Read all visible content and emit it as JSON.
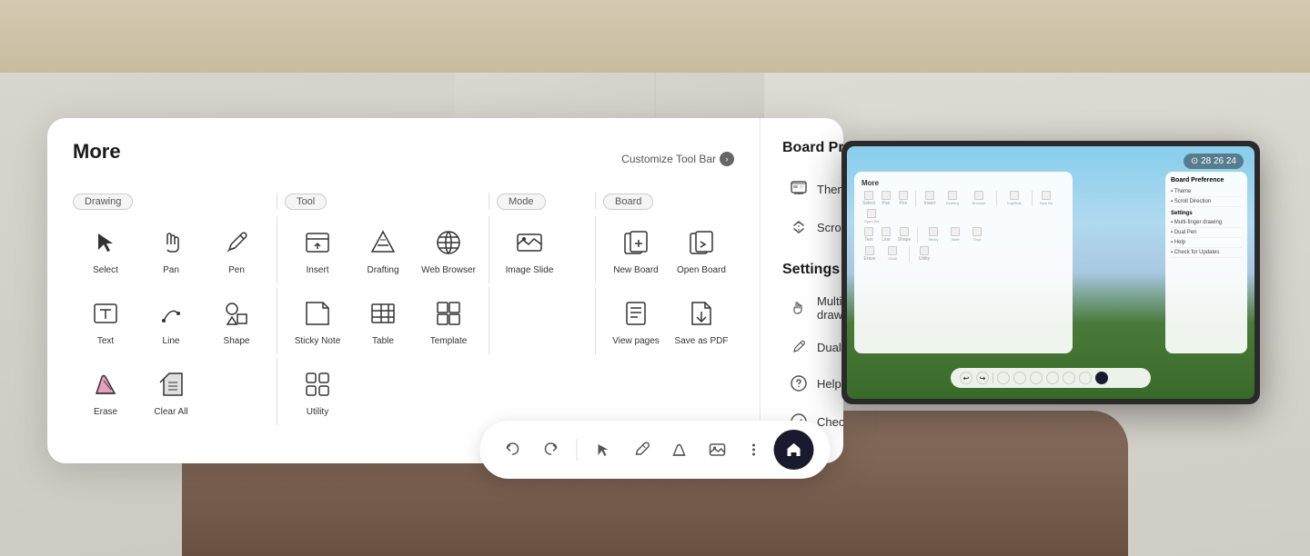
{
  "panel": {
    "title": "More",
    "customize_bar": "Customize Tool Bar",
    "categories": {
      "drawing": "Drawing",
      "tool": "Tool",
      "mode": "Mode",
      "board": "Board"
    },
    "tools": {
      "drawing": [
        {
          "id": "select",
          "label": "Select"
        },
        {
          "id": "pan",
          "label": "Pan"
        },
        {
          "id": "pen",
          "label": "Pen"
        }
      ],
      "tool": [
        {
          "id": "insert",
          "label": "Insert"
        },
        {
          "id": "drafting",
          "label": "Drafting"
        },
        {
          "id": "web-browser",
          "label": "Web Browser"
        }
      ],
      "mode": [
        {
          "id": "image-slide",
          "label": "Image Slide"
        }
      ],
      "board": [
        {
          "id": "new-board",
          "label": "New Board"
        },
        {
          "id": "open-board",
          "label": "Open Board"
        }
      ],
      "drawing2": [
        {
          "id": "text",
          "label": "Text"
        },
        {
          "id": "line",
          "label": "Line"
        },
        {
          "id": "shape",
          "label": "Shape"
        }
      ],
      "tool2": [
        {
          "id": "sticky-note",
          "label": "Sticky Note"
        },
        {
          "id": "table",
          "label": "Table"
        },
        {
          "id": "template",
          "label": "Template"
        }
      ],
      "mode2": [],
      "board2": [
        {
          "id": "view-pages",
          "label": "View pages"
        },
        {
          "id": "save-as-pdf",
          "label": "Save as PDF"
        }
      ],
      "drawing3": [
        {
          "id": "erase",
          "label": "Erase"
        },
        {
          "id": "clear-all",
          "label": "Clear All"
        }
      ],
      "tool3": [
        {
          "id": "utility",
          "label": "Utility"
        }
      ]
    }
  },
  "board_preference": {
    "title": "Board Preference",
    "items": [
      {
        "id": "theme",
        "label": "Theme"
      },
      {
        "id": "scroll-direction",
        "label": "Scroll Direction"
      }
    ]
  },
  "settings": {
    "title": "Settings",
    "toggle_items": [
      {
        "id": "multi-finger-drawing",
        "label": "Multi-finger drawing",
        "enabled": false
      },
      {
        "id": "dual-pen",
        "label": "Dual Pen",
        "enabled": false
      }
    ],
    "menu_items": [
      {
        "id": "help",
        "label": "Help"
      },
      {
        "id": "check-for-updates",
        "label": "Check for Updates"
      }
    ]
  },
  "toolbar": {
    "buttons": [
      {
        "id": "undo",
        "label": "Undo"
      },
      {
        "id": "redo",
        "label": "Redo"
      },
      {
        "id": "select",
        "label": "Select"
      },
      {
        "id": "pen",
        "label": "Pen"
      },
      {
        "id": "eraser",
        "label": "Eraser"
      },
      {
        "id": "image",
        "label": "Image"
      },
      {
        "id": "more",
        "label": "More"
      }
    ],
    "active_button": "home"
  },
  "tv": {
    "time": "⊙ 28 26 24",
    "panel_title": "More",
    "right_title": "Board Preference"
  },
  "colors": {
    "accent": "#1a1a2e",
    "panel_bg": "#ffffff",
    "border": "#e8e8e8"
  }
}
